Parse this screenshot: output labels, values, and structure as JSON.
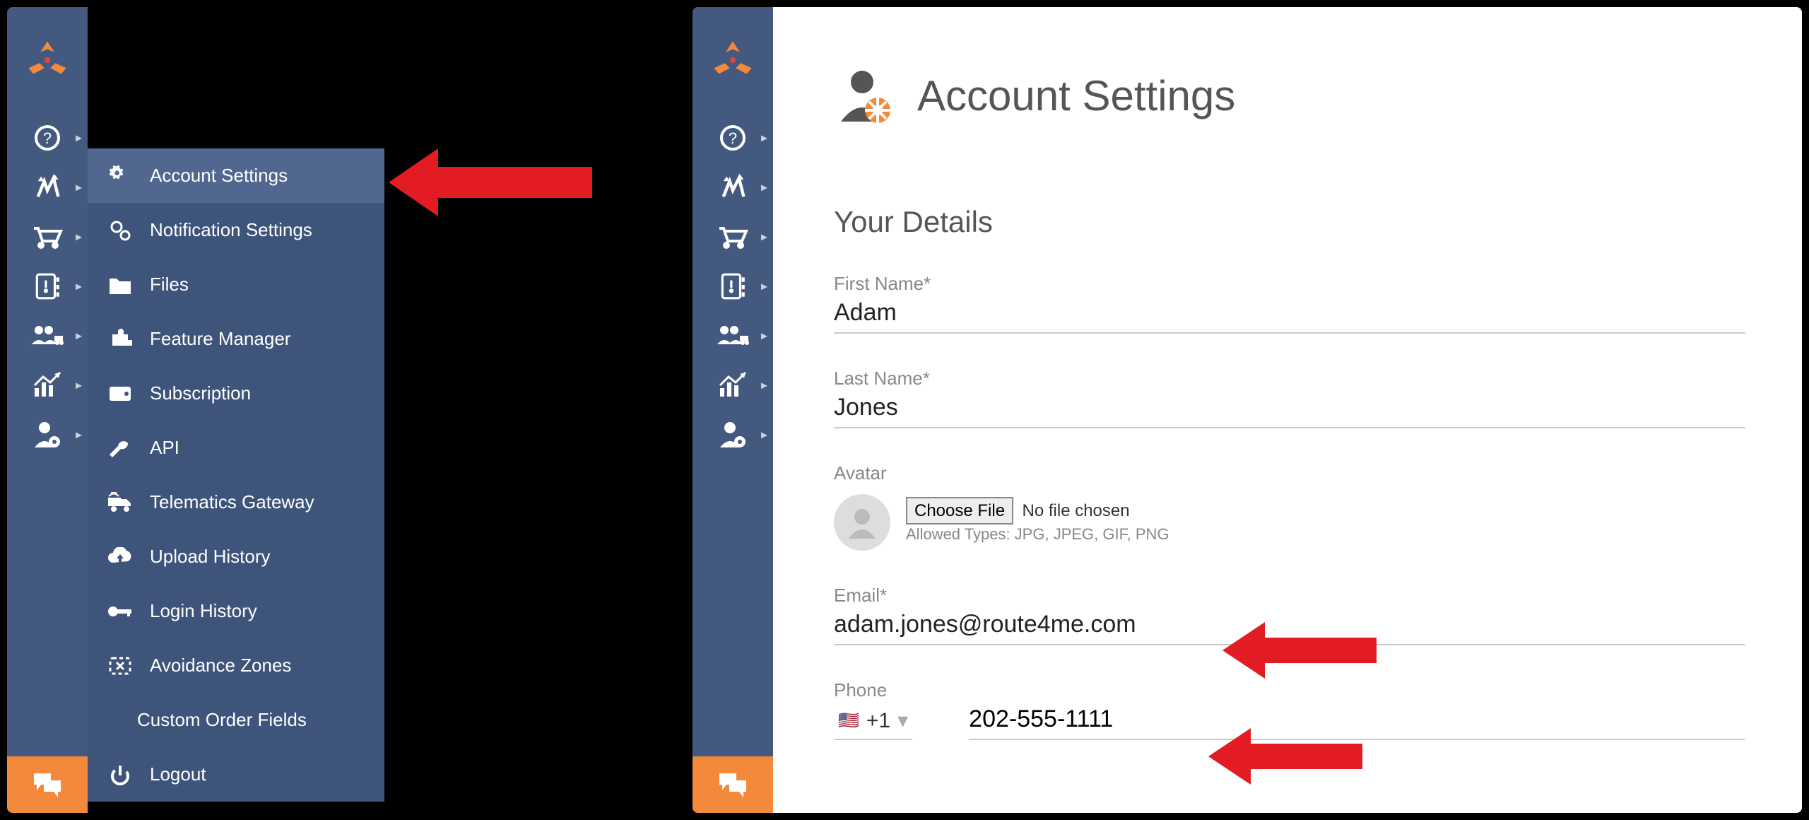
{
  "flyout": {
    "items": [
      {
        "label": "Account Settings",
        "icon": "gear"
      },
      {
        "label": "Notification Settings",
        "icon": "gears"
      },
      {
        "label": "Files",
        "icon": "folder"
      },
      {
        "label": "Feature Manager",
        "icon": "puzzle"
      },
      {
        "label": "Subscription",
        "icon": "wallet"
      },
      {
        "label": "API",
        "icon": "wrench"
      },
      {
        "label": "Telematics Gateway",
        "icon": "truck"
      },
      {
        "label": "Upload History",
        "icon": "cloud"
      },
      {
        "label": "Login History",
        "icon": "key"
      },
      {
        "label": "Avoidance Zones",
        "icon": "zone"
      },
      {
        "label": "Custom Order Fields",
        "icon": ""
      },
      {
        "label": "Logout",
        "icon": "power"
      }
    ]
  },
  "page": {
    "title": "Account Settings",
    "section": "Your Details",
    "first_name_label": "First Name*",
    "first_name": "Adam",
    "last_name_label": "Last Name*",
    "last_name": "Jones",
    "avatar_label": "Avatar",
    "choose_file": "Choose File",
    "no_file": "No file chosen",
    "allowed": "Allowed Types: JPG, JPEG, GIF, PNG",
    "email_label": "Email*",
    "email": "adam.jones@route4me.com",
    "phone_label": "Phone",
    "phone_cc": "+1",
    "phone": "202-555-1111"
  }
}
